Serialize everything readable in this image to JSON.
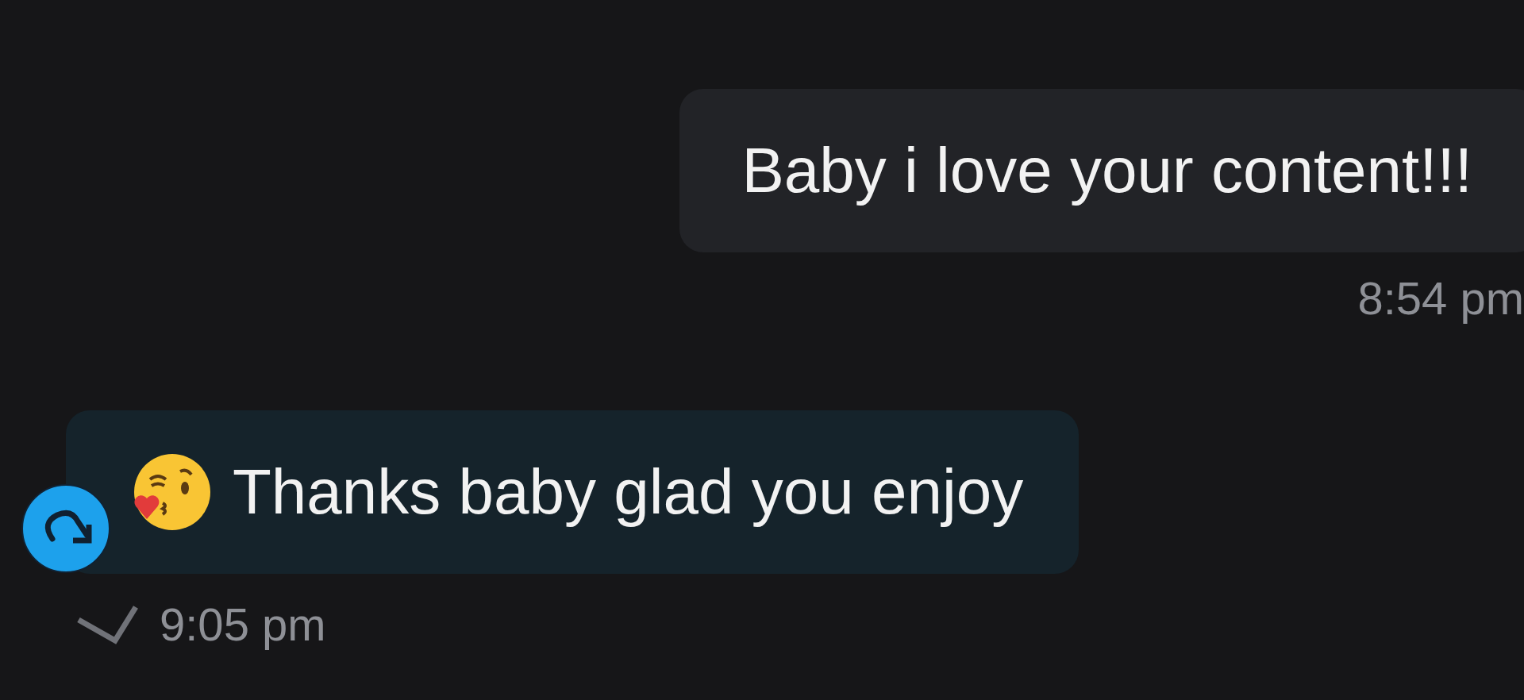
{
  "messages": [
    {
      "kind": "sent",
      "text": "Baby i love your content!!!",
      "time": "8:54 pm",
      "delivered": false
    },
    {
      "kind": "received",
      "text": "Thanks baby glad you enjoy",
      "time": "9:05 pm",
      "delivered": true
    }
  ]
}
